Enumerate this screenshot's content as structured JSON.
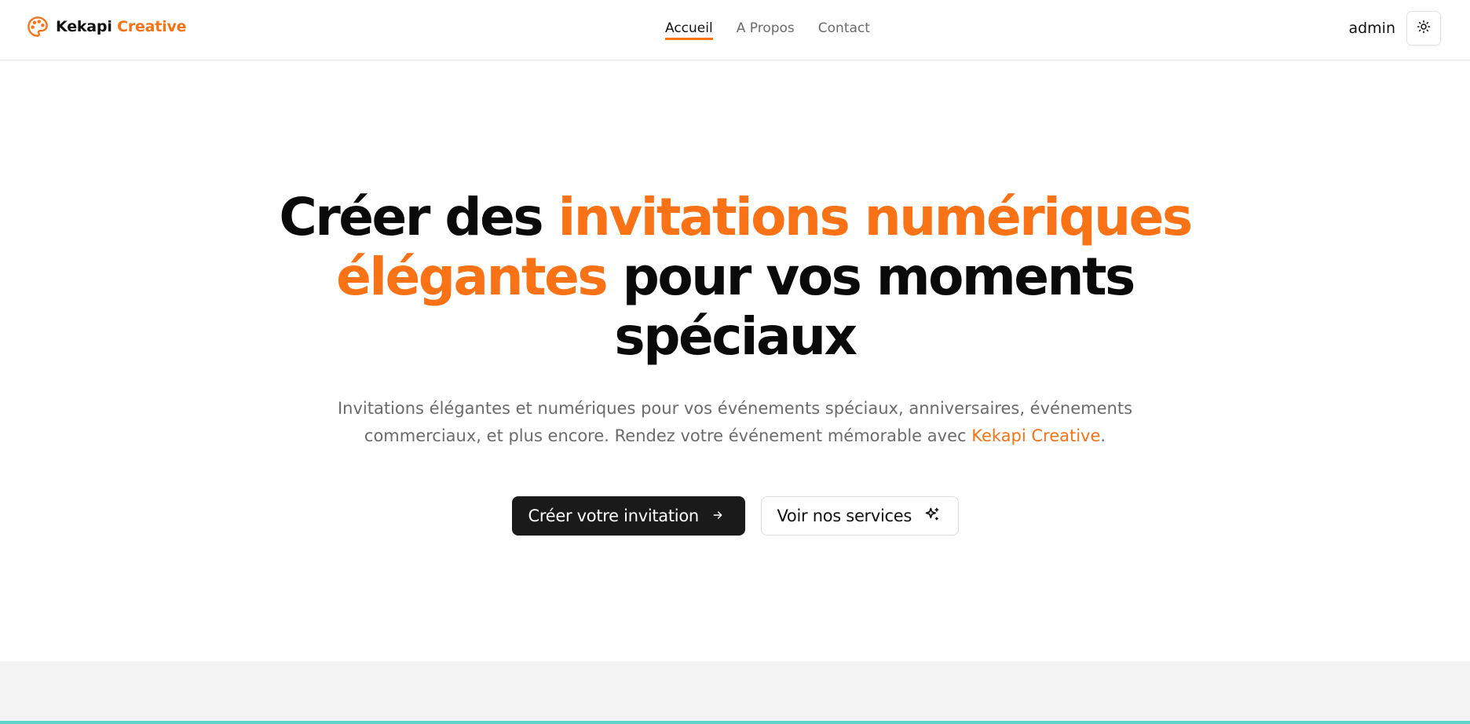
{
  "brand": {
    "name_part1": "Kekapi",
    "name_part2": "Creative",
    "logo_icon": "palette-icon",
    "accent_color": "#f97316"
  },
  "nav": {
    "items": [
      {
        "label": "Accueil",
        "active": true
      },
      {
        "label": "A Propos",
        "active": false
      },
      {
        "label": "Contact",
        "active": false
      }
    ]
  },
  "header": {
    "user_name": "admin",
    "theme_toggle_icon": "sun-icon"
  },
  "hero": {
    "title_part1": "Créer des ",
    "title_highlight": "invitations numériques élégantes",
    "title_part2": " pour vos moments spéciaux",
    "subtitle_text": "Invitations élégantes et numériques pour vos événements spéciaux, anniversaires, événements commerciaux, et plus encore. Rendez votre événement mémorable avec ",
    "subtitle_brand": "Kekapi Creative",
    "subtitle_end": "."
  },
  "cta": {
    "primary_label": "Créer votre invitation",
    "primary_icon": "arrow-right-icon",
    "secondary_label": "Voir nos services",
    "secondary_icon": "sparkles-icon"
  },
  "colors": {
    "primary_dark": "#1a1a1a",
    "muted_text": "#6b6b6b",
    "band_bg": "#f3f3f3",
    "band_line": "#5fd4c8"
  }
}
